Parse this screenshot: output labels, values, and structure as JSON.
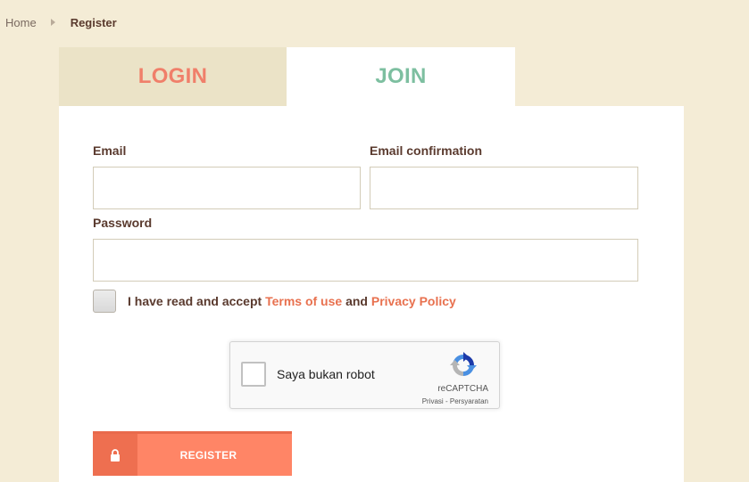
{
  "breadcrumb": {
    "home": "Home",
    "current": "Register"
  },
  "tabs": {
    "login": "LOGIN",
    "join": "JOIN"
  },
  "form": {
    "email_label": "Email",
    "email_value": "",
    "email_confirmation_label": "Email confirmation",
    "email_confirmation_value": "",
    "password_label": "Password",
    "password_value": "",
    "accept": {
      "prefix": "I have read and accept",
      "terms_link": "Terms of use",
      "and": "and",
      "privacy_link": "Privacy Policy"
    }
  },
  "recaptcha": {
    "label": "Saya bukan robot",
    "brand": "reCAPTCHA",
    "privacy": "Privasi",
    "separator": "-",
    "terms": "Persyaratan"
  },
  "register": {
    "label": "REGISTER",
    "icon": "lock-icon"
  },
  "colors": {
    "page_background": "#f4ecd6",
    "login_tab_text": "#f07f6a",
    "join_tab_text": "#7dbfa0",
    "link": "#e8714f",
    "button": "#ff8566",
    "button_icon_bg": "#ee6f50"
  }
}
